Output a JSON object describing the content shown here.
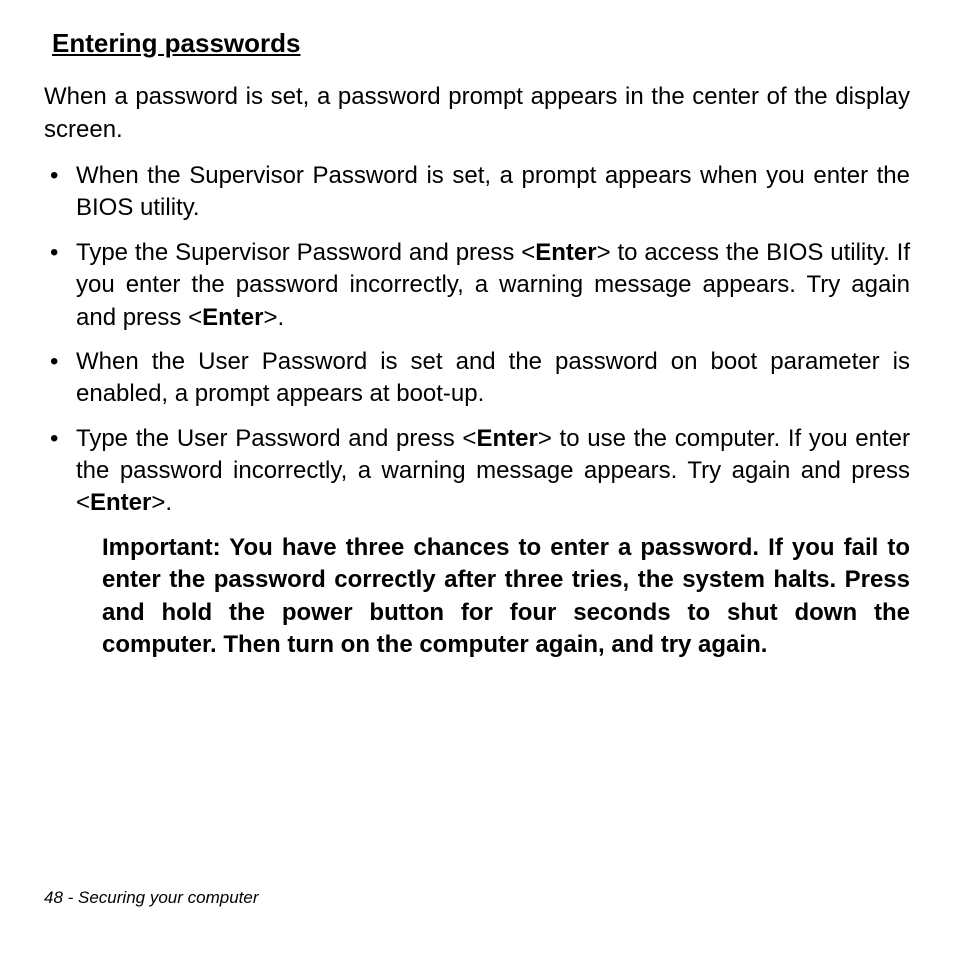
{
  "heading": "Entering passwords",
  "intro": "When a password is set, a password prompt appears in the center of the display screen.",
  "bullet_marker": "•",
  "bullets": {
    "b1": "When the Supervisor Password is set, a prompt appears when you enter the BIOS utility.",
    "b2a": "Type the Supervisor Password and press <",
    "b2b": "Enter",
    "b2c": "> to access the BIOS utility. If you enter the password incorrectly, a warning message appears. Try again and press <",
    "b2d": "Enter",
    "b2e": ">.",
    "b3": "When the User Password is set and the password on boot parameter is enabled, a prompt appears at boot-up.",
    "b4a": "Type the User Password and press <",
    "b4b": "Enter",
    "b4c": "> to use the computer. If you enter the password incorrectly, a warning message appears. Try again and press <",
    "b4d": "Enter",
    "b4e": ">."
  },
  "note": "Important: You have three chances to enter a password. If you fail to enter the password correctly after three tries, the system halts. Press and hold the power button for four seconds to shut down the computer. Then turn on the computer again, and try again.",
  "footer": "48 - Securing your computer"
}
